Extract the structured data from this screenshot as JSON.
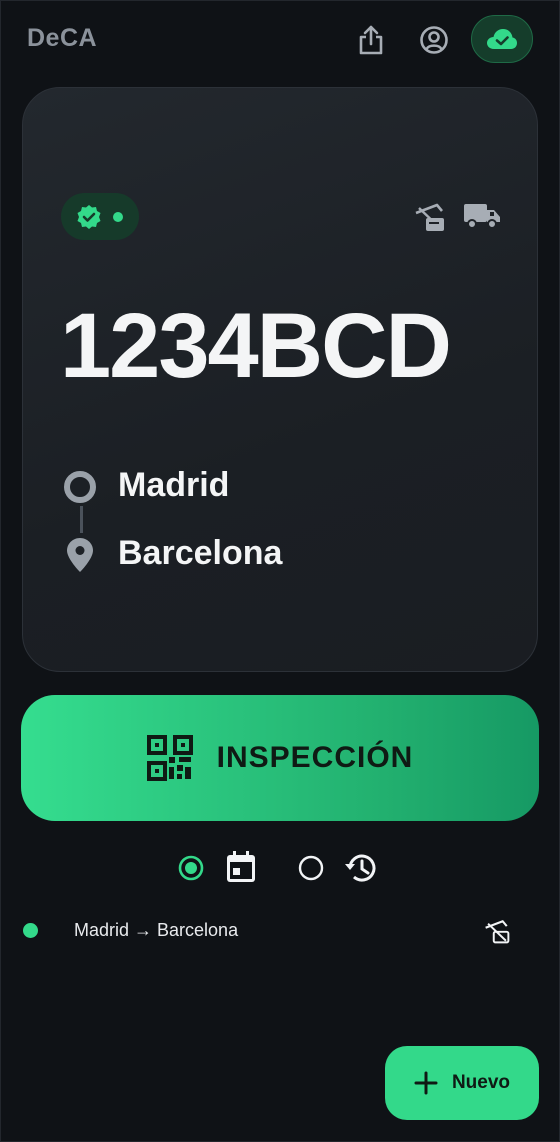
{
  "app": {
    "title": "DeCA"
  },
  "header": {
    "share_icon": "share-icon",
    "account_icon": "account-circle-icon",
    "sync_icon": "cloud-check-icon"
  },
  "vehicle_card": {
    "plate": "1234BCD",
    "status_icon": "verified-badge-icon",
    "origin": "Madrid",
    "destination": "Barcelona"
  },
  "inspection_button": {
    "label": "INSPECCIÓN"
  },
  "filters": {
    "selected": "calendar",
    "options": [
      "calendar",
      "history"
    ]
  },
  "list": [
    {
      "route": "Madrid → Barcelona",
      "status_color": "#33d98a"
    }
  ],
  "fab": {
    "label": "Nuevo"
  },
  "colors": {
    "accent": "#33d98a",
    "background": "#0f1216",
    "card": "#1e2227"
  }
}
